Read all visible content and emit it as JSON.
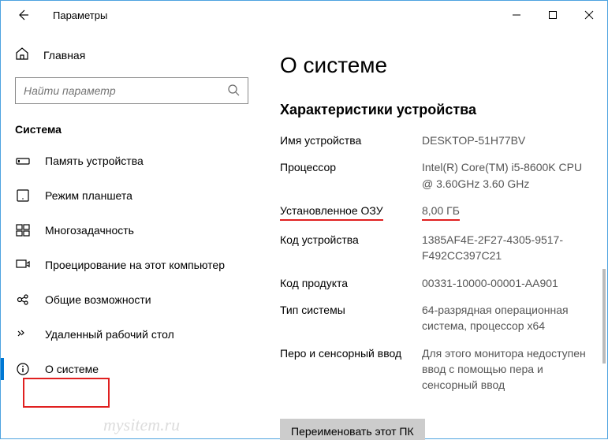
{
  "titlebar": {
    "title": "Параметры"
  },
  "sidebar": {
    "home": "Главная",
    "search_placeholder": "Найти параметр",
    "category": "Система",
    "items": [
      {
        "label": "Память устройства"
      },
      {
        "label": "Режим планшета"
      },
      {
        "label": "Многозадачность"
      },
      {
        "label": "Проецирование на этот компьютер"
      },
      {
        "label": "Общие возможности"
      },
      {
        "label": "Удаленный рабочий стол"
      },
      {
        "label": "О системе"
      }
    ]
  },
  "main": {
    "heading": "О системе",
    "section": "Характеристики устройства",
    "specs": {
      "device_name_label": "Имя устройства",
      "device_name_value": "DESKTOP-51H77BV",
      "processor_label": "Процессор",
      "processor_value": "Intel(R) Core(TM) i5-8600K CPU @ 3.60GHz   3.60 GHz",
      "ram_label": "Установленное ОЗУ",
      "ram_value": "8,00 ГБ",
      "device_id_label": "Код устройства",
      "device_id_value": "1385AF4E-2F27-4305-9517-F492CC397C21",
      "product_id_label": "Код продукта",
      "product_id_value": "00331-10000-00001-AA901",
      "system_type_label": "Тип системы",
      "system_type_value": "64-разрядная операционная система, процессор x64",
      "pen_touch_label": "Перо и сенсорный ввод",
      "pen_touch_value": "Для этого монитора недоступен ввод с помощью пера и сенсорный ввод"
    },
    "rename_button": "Переименовать этот ПК"
  },
  "watermark": "mysitem.ru"
}
